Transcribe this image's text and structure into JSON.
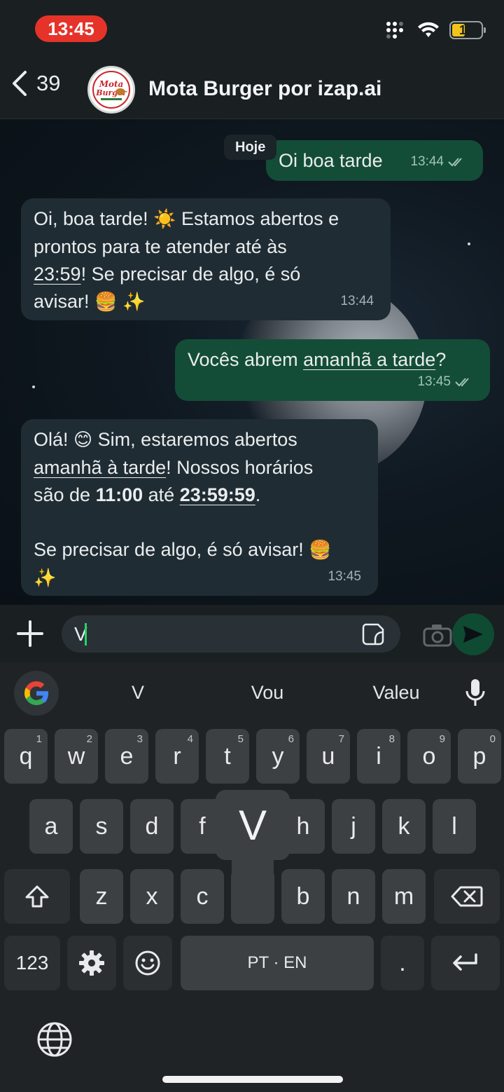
{
  "status_bar": {
    "time": "13:45",
    "battery": "18"
  },
  "header": {
    "back_count": "39",
    "title": "Mota Burger por izap.ai",
    "avatar_text": "Mota Burger"
  },
  "chat": {
    "day_label": "Hoje",
    "messages": [
      {
        "dir": "out",
        "text": "Oi boa tarde",
        "time": "13:44",
        "read": true
      },
      {
        "dir": "in",
        "line1a": "Oi, boa tarde!",
        "line1b": "Estamos abertos e",
        "line2": "prontos para te atender até às",
        "line3_u": "23:59",
        "line3_rest": "! Se precisar de algo, é só",
        "line4": "avisar!",
        "time": "13:44"
      },
      {
        "dir": "out",
        "pre": "Vocês abrem ",
        "u": "amanhã a tarde",
        "post": "?",
        "time": "13:45",
        "read": true
      },
      {
        "dir": "in",
        "l1a": "Olá!",
        "l1b": "Sim, estaremos abertos",
        "l2_u": "amanhã à tarde",
        "l2_rest": "! Nossos horários",
        "l3_a": "são de ",
        "l3_b": "11:00",
        "l3_c": " até ",
        "l3_u": "23:59:59",
        "l3_d": ".",
        "l4": "Se precisar de algo, é só avisar!",
        "time": "13:45"
      }
    ]
  },
  "input": {
    "value": "V"
  },
  "keyboard": {
    "suggestions": [
      "V",
      "Vou",
      "Valeu"
    ],
    "row1": [
      [
        "q",
        "1"
      ],
      [
        "w",
        "2"
      ],
      [
        "e",
        "3"
      ],
      [
        "r",
        "4"
      ],
      [
        "t",
        "5"
      ],
      [
        "y",
        "6"
      ],
      [
        "u",
        "7"
      ],
      [
        "i",
        "8"
      ],
      [
        "o",
        "9"
      ],
      [
        "p",
        "0"
      ]
    ],
    "row2": [
      "a",
      "s",
      "d",
      "f",
      "g",
      "h",
      "j",
      "k",
      "l"
    ],
    "row3": [
      "z",
      "x",
      "c",
      "v",
      "b",
      "n",
      "m"
    ],
    "popup_key": "V",
    "numbers_key": "123",
    "space_label": "PT · EN",
    "period_key": "."
  },
  "colors": {
    "outgoing_bubble": "#144d37",
    "incoming_bubble": "#202c33",
    "accent": "#25d366",
    "time_pill": "#e5332a"
  }
}
